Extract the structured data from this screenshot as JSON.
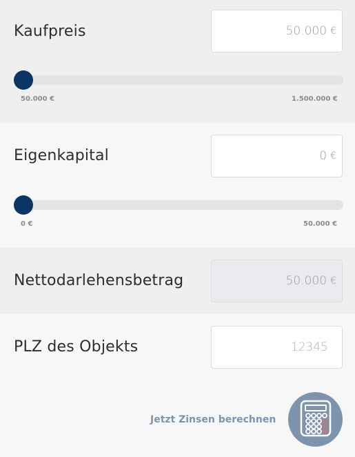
{
  "purchase_price": {
    "label": "Kaufpreis",
    "value": "50.000",
    "unit": "€",
    "slider_fraction": 0,
    "min_label": "50.000 €",
    "max_label": "1.500.000 €"
  },
  "equity": {
    "label": "Eigenkapital",
    "value": "0",
    "unit": "€",
    "slider_fraction": 0,
    "min_label": "0 €",
    "max_label": "50.000 €"
  },
  "net_loan": {
    "label": "Nettodarlehensbetrag",
    "value": "50.000",
    "unit": "€"
  },
  "postal_code": {
    "label": "PLZ des Objekts",
    "placeholder": "12345"
  },
  "cta": {
    "label": "Jetzt Zinsen berechnen",
    "icon": "calculator-icon"
  },
  "colors": {
    "slider_thumb": "#0b3563",
    "accent": "#7e94ad"
  }
}
